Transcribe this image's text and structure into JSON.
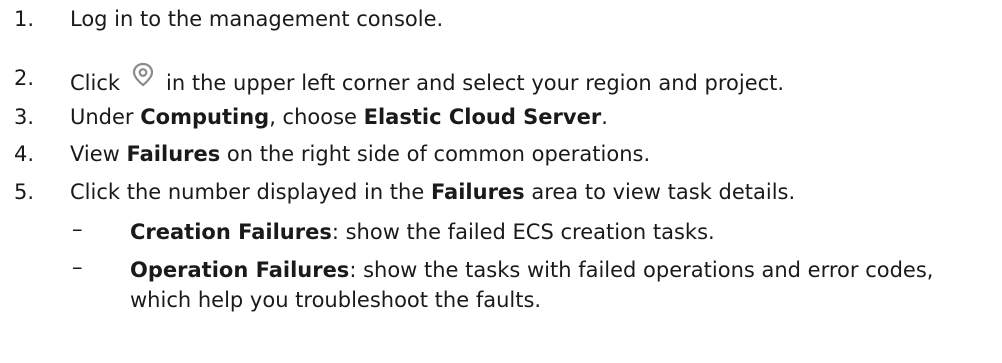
{
  "steps": [
    {
      "num": "1.",
      "text": "Log in to the management console."
    },
    {
      "num": "2.",
      "before": "Click",
      "icon": "location-pin-icon",
      "after": "in the upper left corner and select your region and project."
    },
    {
      "num": "3.",
      "a": "Under ",
      "b1": "Computing",
      "c": ", choose ",
      "b2": "Elastic Cloud Server",
      "d": "."
    },
    {
      "num": "4.",
      "a": "View ",
      "b1": "Failures",
      "c": " on the right side of common operations."
    },
    {
      "num": "5.",
      "a": "Click the number displayed in the ",
      "b1": "Failures",
      "c": " area to view task details."
    }
  ],
  "subitems": [
    {
      "dash": "–",
      "bold": "Creation Failures",
      "rest": ": show the failed ECS creation tasks."
    },
    {
      "dash": "–",
      "bold": "Operation Failures",
      "rest": ": show the tasks with failed operations and error codes, which help you troubleshoot the faults."
    }
  ],
  "colors": {
    "text": "#1a1a1a",
    "icon": "#8a8a8a"
  }
}
